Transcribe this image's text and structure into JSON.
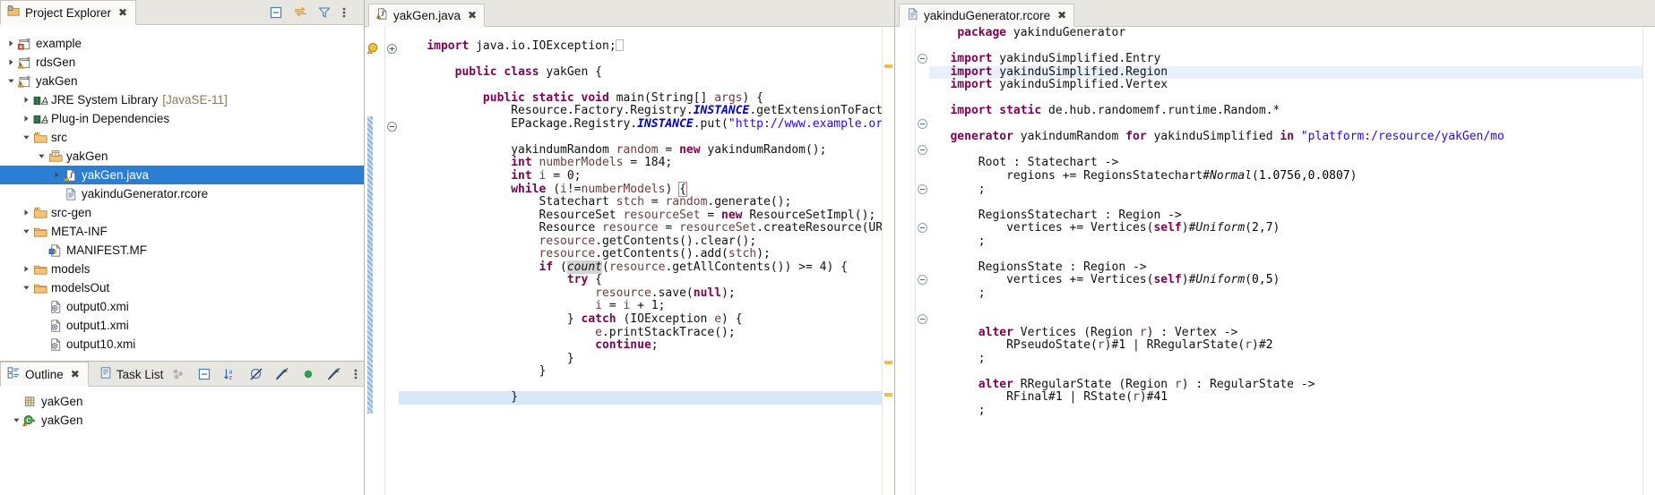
{
  "project_explorer": {
    "tab_label": "Project Explorer",
    "close_glyph": "✖",
    "toolbar_icons": [
      "collapse-all-icon",
      "link-with-editor-icon",
      "view-menu-filter-icon",
      "view-menu-icon"
    ],
    "tree": [
      {
        "label": "example",
        "indent": 0,
        "arrow": "collapsed",
        "icon": "project-error-icon"
      },
      {
        "label": "rdsGen",
        "indent": 0,
        "arrow": "collapsed",
        "icon": "project-warning-icon"
      },
      {
        "label": "yakGen",
        "indent": 0,
        "arrow": "expanded",
        "icon": "project-warning-icon"
      },
      {
        "label": "JRE System Library",
        "indent": 1,
        "arrow": "collapsed",
        "icon": "library-icon",
        "suffix": "[JavaSE-11]"
      },
      {
        "label": "Plug-in Dependencies",
        "indent": 1,
        "arrow": "collapsed",
        "icon": "library-icon"
      },
      {
        "label": "src",
        "indent": 1,
        "arrow": "expanded",
        "icon": "source-folder-icon"
      },
      {
        "label": "yakGen",
        "indent": 2,
        "arrow": "expanded",
        "icon": "package-icon"
      },
      {
        "label": "yakGen.java",
        "indent": 3,
        "arrow": "collapsed",
        "icon": "java-file-warning-icon",
        "selected": true
      },
      {
        "label": "yakinduGenerator.rcore",
        "indent": 3,
        "arrow": "none",
        "icon": "text-file-icon"
      },
      {
        "label": "src-gen",
        "indent": 1,
        "arrow": "collapsed",
        "icon": "source-folder-icon"
      },
      {
        "label": "META-INF",
        "indent": 1,
        "arrow": "expanded",
        "icon": "folder-icon"
      },
      {
        "label": "MANIFEST.MF",
        "indent": 2,
        "arrow": "none",
        "icon": "manifest-icon"
      },
      {
        "label": "models",
        "indent": 1,
        "arrow": "collapsed",
        "icon": "folder-icon"
      },
      {
        "label": "modelsOut",
        "indent": 1,
        "arrow": "expanded",
        "icon": "folder-icon"
      },
      {
        "label": "output0.xmi",
        "indent": 2,
        "arrow": "none",
        "icon": "xmi-file-icon"
      },
      {
        "label": "output1.xmi",
        "indent": 2,
        "arrow": "none",
        "icon": "xmi-file-icon"
      },
      {
        "label": "output10.xmi",
        "indent": 2,
        "arrow": "none",
        "icon": "xmi-file-icon"
      }
    ]
  },
  "outline_panel": {
    "tabs": [
      {
        "label": "Outline",
        "active": true,
        "icon": "outline-icon",
        "close_glyph": "✖"
      },
      {
        "label": "Task List",
        "active": false,
        "icon": "task-list-icon"
      }
    ],
    "toolbar_icons": [
      "group-icon",
      "collapse-all-icon",
      "sort-az-icon",
      "hide-fields-icon",
      "hide-static-icon",
      "hide-nonpublic-icon",
      "hide-local-icon",
      "view-menu-icon"
    ],
    "tree": [
      {
        "label": "yakGen",
        "indent": 0,
        "arrow": "none",
        "icon": "package-declaration-icon"
      },
      {
        "label": "yakGen",
        "indent": 0,
        "arrow": "expanded",
        "icon": "class-warning-icon"
      }
    ]
  },
  "java_editor": {
    "tab": {
      "label": "yakGen.java",
      "icon": "java-file-warning-icon",
      "close_glyph": "✖"
    },
    "lines": [
      {
        "t": "import",
        "warn": true,
        "fold": "plus"
      },
      {
        "t": "blank"
      },
      {
        "t": "class_decl"
      },
      {
        "t": "blank"
      },
      {
        "t": "main_decl",
        "fold": "minus",
        "change": true
      },
      {
        "t": "resource_factory",
        "change": true
      },
      {
        "t": "epackage_registry",
        "change": true
      },
      {
        "t": "blank",
        "change": true
      },
      {
        "t": "random_decl",
        "change": true
      },
      {
        "t": "number_models",
        "change": true
      },
      {
        "t": "i_zero",
        "change": true
      },
      {
        "t": "while",
        "change": true
      },
      {
        "t": "statechart",
        "change": true
      },
      {
        "t": "resourceset",
        "change": true
      },
      {
        "t": "resource_create",
        "change": true
      },
      {
        "t": "clear",
        "change": true
      },
      {
        "t": "add_stch",
        "change": true
      },
      {
        "t": "if_count",
        "change": true
      },
      {
        "t": "try",
        "change": true
      },
      {
        "t": "save_null",
        "change": true
      },
      {
        "t": "i_inc",
        "change": true
      },
      {
        "t": "catch",
        "change": true
      },
      {
        "t": "printstack",
        "change": true
      },
      {
        "t": "continue",
        "change": true
      },
      {
        "t": "close_catch",
        "change": true
      },
      {
        "t": "close_if",
        "change": true
      },
      {
        "t": "blank"
      },
      {
        "t": "close_while",
        "highlight": true
      }
    ],
    "text": {
      "import_stmt": "import java.io.IOException;",
      "class_decl": "public class yakGen {",
      "main_decl": "public static void main(String[] args) {",
      "resource_factory": "Resource.Factory.Registry.INSTANCE.getExtensionToFactoryMap().put(\"xmi\"",
      "epackage_registry": "EPackage.Registry.INSTANCE.put(\"http://www.example.org/yakinduSimplifie",
      "random_decl": "yakindumRandom random = new yakindumRandom();",
      "number_models": "int numberModels = 184;",
      "i_zero": "int i = 0;",
      "while_stmt": "while (i!=numberModels) {",
      "statechart": "Statechart stch = random.generate();",
      "resourceset": "ResourceSet resourceSet = new ResourceSetImpl();",
      "resource_create": "Resource resource = resourceSet.createResource(URI.createURI(\"model",
      "clear": "resource.getContents().clear();",
      "add_stch": "resource.getContents().add(stch);",
      "if_count": "if (count(resource.getAllContents()) >= 4) {",
      "try": "try {",
      "save_null": "resource.save(null);",
      "i_inc": "i = i + 1;",
      "catch": "} catch (IOException e) {",
      "printstack": "e.printStackTrace();",
      "continue": "continue;",
      "close_catch": "}",
      "close_if": "}",
      "close_while": "}"
    }
  },
  "rcore_editor": {
    "tab": {
      "label": "yakinduGenerator.rcore",
      "icon": "text-file-icon",
      "close_glyph": "✖"
    },
    "text": {
      "package": "package yakinduGenerator",
      "import_entry": "import yakinduSimplified.Entry",
      "import_region": "import yakinduSimplified.Region",
      "import_vertex": "import yakinduSimplified.Vertex",
      "import_static": "import static de.hub.randomemf.runtime.Random.*",
      "generator": "generator yakindumRandom for yakinduSimplified in \"platform:/resource/yakGen/mo",
      "root_rule": "Root : Statechart ->",
      "root_body": "regions += RegionsStatechart#Normal(1.0756,0.0807)",
      "regions_statechart_rule": "RegionsStatechart : Region ->",
      "regions_statechart_body": "vertices += Vertices(self)#Uniform(2,7)",
      "regions_state_rule": "RegionsState : Region ->",
      "regions_state_body": "vertices += Vertices(self)#Uniform(0,5)",
      "alter_vertices_rule": "alter Vertices (Region r) : Vertex ->",
      "alter_vertices_body": "RPseudoState(r)#1 | RRegularState(r)#2",
      "alter_regular_rule": "alter RRegularState (Region r) : RegularState ->",
      "alter_regular_body": "RFinal#1 | RState(r)#41",
      "semicolon": ";"
    }
  },
  "colors": {
    "selection_blue": "#2a7fd4",
    "keyword_purple": "#7f0055",
    "string_blue": "#2a00ff",
    "static_blue": "#0000c0",
    "field_brown": "#6a3e3e",
    "highlight_line": "#e8f1fb",
    "tab_bar_grey": "#e8e6e1",
    "folder_orange": "#e8a33d"
  }
}
